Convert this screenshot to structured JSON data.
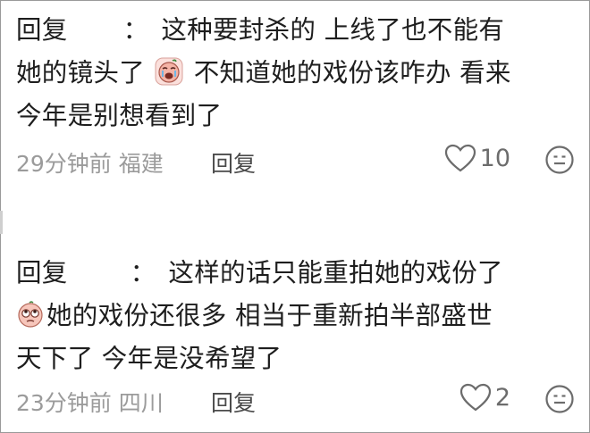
{
  "comments": [
    {
      "reply_prefix": "回复",
      "colon": "：",
      "line1": "这种要封杀的 上线了也不能有",
      "line2a": "她的镜头了",
      "line2b": "不知道她的戏份该咋办 看来",
      "line3": "今年是别想看到了",
      "time": "29分钟前",
      "location": "福建",
      "reply_label": "回复",
      "likes": "10",
      "emoji_icon": "crying-face-icon"
    },
    {
      "reply_prefix": "回复",
      "colon": "：",
      "line1": "这样的话只能重拍她的戏份了",
      "line2": "她的戏份还很多 相当于重新拍半部盛世",
      "line3": "天下了 今年是没希望了",
      "time": "23分钟前",
      "location": "四川",
      "reply_label": "回复",
      "likes": "2",
      "emoji_icon": "eye-roll-face-icon"
    }
  ],
  "colors": {
    "text": "#1e1e1e",
    "meta": "#9b9b9b",
    "border": "#9a9a9a"
  }
}
